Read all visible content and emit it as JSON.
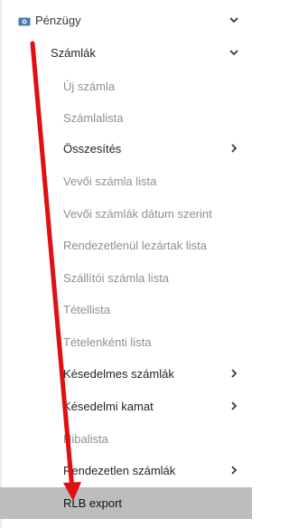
{
  "menu": {
    "root": {
      "label": "Pénzügy",
      "icon": "money-icon"
    },
    "section": {
      "label": "Számlák"
    },
    "items": [
      {
        "label": "Új számla"
      },
      {
        "label": "Számlalista"
      },
      {
        "label": "Összesítés"
      },
      {
        "label": "Vevői számla lista"
      },
      {
        "label": "Vevői számlák dátum szerint"
      },
      {
        "label": "Rendezetlenül lezártak lista"
      },
      {
        "label": "Szállítói számla lista"
      },
      {
        "label": "Tétellista"
      },
      {
        "label": "Tételenkénti lista"
      },
      {
        "label": "Késedelmes számlák"
      },
      {
        "label": "Késedelmi kamat"
      },
      {
        "label": "Hibalista"
      },
      {
        "label": "Rendezetlen számlák"
      },
      {
        "label": "RLB export"
      }
    ]
  },
  "colors": {
    "active_bg": "#bdbdbd",
    "arrow": "#e01010",
    "muted_text": "#8a9099",
    "icon": "#4a78b8"
  }
}
